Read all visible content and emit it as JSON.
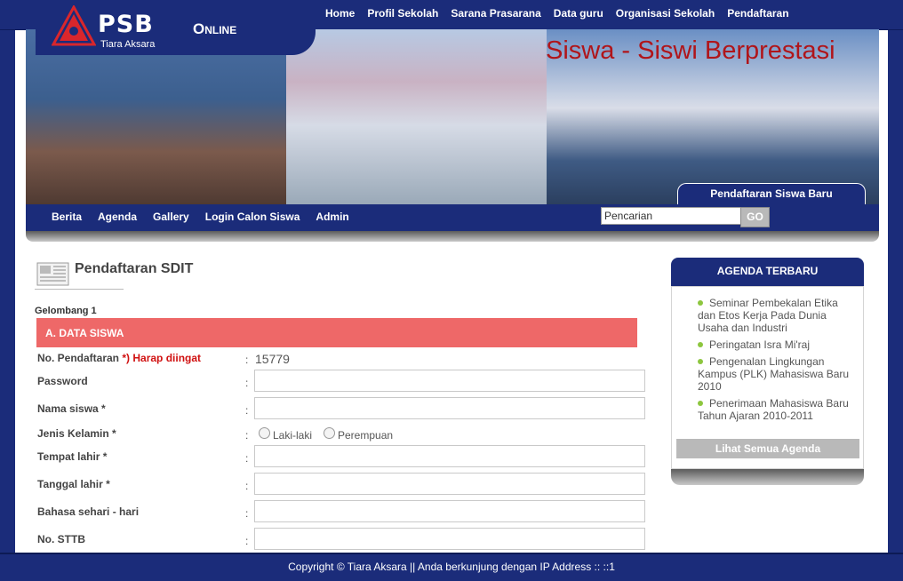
{
  "header": {
    "logo_text": "PSB",
    "logo_suffix": "Online",
    "logo_sub": "Tiara Aksara",
    "nav": [
      "Home",
      "Profil Sekolah",
      "Sarana Prasarana",
      "Data guru",
      "Organisasi Sekolah",
      "Pendaftaran"
    ]
  },
  "banner": {
    "title": "Siswa - Siswi Berprestasi",
    "tab": "Pendaftaran Siswa Baru"
  },
  "subnav": {
    "items": [
      "Berita",
      "Agenda",
      "Gallery",
      "Login Calon Siswa",
      "Admin"
    ],
    "search_value": "Pencarian",
    "search_button": "GO"
  },
  "main": {
    "title": "Pendaftaran SDIT",
    "gelombang": "Gelombang 1",
    "section": "A. DATA SISWA",
    "no_pendaftaran_label": "No. Pendaftaran",
    "no_pendaftaran_note": "*) Harap diingat",
    "no_pendaftaran_value": "15779",
    "password_label": "Password",
    "nama_label": "Nama siswa *",
    "jenis_label": "Jenis Kelamin *",
    "radio_laki": "Laki-laki",
    "radio_perempuan": "Perempuan",
    "tempat_label": "Tempat lahir *",
    "tanggal_label": "Tanggal lahir *",
    "bahasa_label": "Bahasa sehari - hari",
    "stb_label": "No. STTB",
    "colon": ":"
  },
  "sidebar": {
    "title": "AGENDA TERBARU",
    "items": [
      "Seminar Pembekalan Etika dan Etos Kerja Pada Dunia Usaha dan Industri",
      "Peringatan Isra Mi'raj",
      "Pengenalan Lingkungan Kampus (PLK) Mahasiswa Baru 2010",
      "Penerimaan Mahasiswa Baru Tahun Ajaran 2010-2011"
    ],
    "button": "Lihat Semua Agenda"
  },
  "footer": {
    "text": "Copyright © Tiara Aksara || Anda berkunjung dengan IP Address :: ::1"
  },
  "colors": {
    "navy": "#1b2c7a",
    "section_red": "#ee6868",
    "banner_title": "#b0151a"
  }
}
